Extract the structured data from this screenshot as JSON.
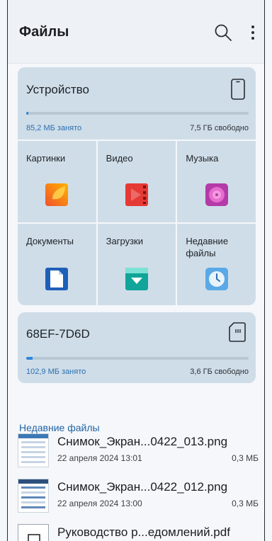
{
  "header": {
    "title": "Файлы",
    "search_icon": "search-icon",
    "more_icon": "more-vert-icon"
  },
  "device": {
    "title": "Устройство",
    "icon": "phone-icon",
    "used": "85,2 МБ занято",
    "free": "7,5 ГБ свободно",
    "usage_fraction": 0.011
  },
  "categories": [
    {
      "label": "Картинки",
      "icon": "images-icon"
    },
    {
      "label": "Видео",
      "icon": "video-icon"
    },
    {
      "label": "Музыка",
      "icon": "music-icon"
    },
    {
      "label": "Документы",
      "icon": "document-icon"
    },
    {
      "label": "Загрузки",
      "icon": "downloads-icon"
    },
    {
      "label": "Недавние файлы",
      "icon": "clock-icon"
    }
  ],
  "sd_card": {
    "title": "68EF-7D6D",
    "icon": "sd-card-icon",
    "used": "102,9 МБ занято",
    "free": "3,6 ГБ свободно",
    "usage_fraction": 0.03
  },
  "recent": {
    "title": "Недавние файлы",
    "files": [
      {
        "name": "Снимок_Экран...0422_013.png",
        "date": "22 апреля 2024 13:01",
        "size": "0,3 МБ"
      },
      {
        "name": "Снимок_Экран...0422_012.png",
        "date": "22 апреля 2024 13:00",
        "size": "0,3 МБ"
      },
      {
        "name": "Руководство р...едомлений.pdf",
        "date": "",
        "size": ""
      }
    ]
  },
  "colors": {
    "accent": "#2e86de",
    "card": "#cfdde8",
    "section_title": "#2264a6"
  }
}
